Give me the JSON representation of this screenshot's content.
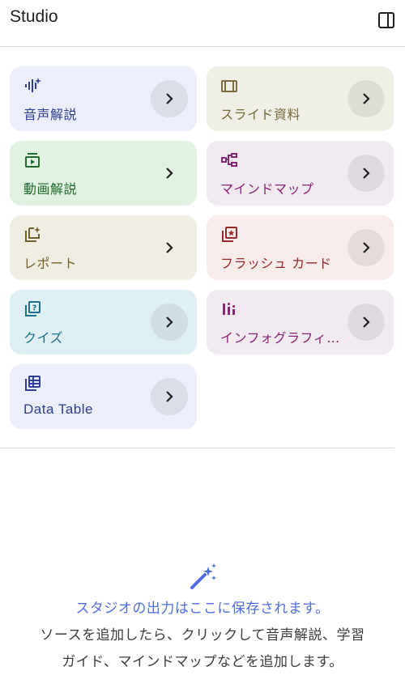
{
  "header": {
    "title": "Studio",
    "panel_icon": "side-panel-icon"
  },
  "cards": [
    {
      "label": "音声解説",
      "icon": "audio-waveform-icon",
      "bg": "#eceefb",
      "fg": "#2f3f94"
    },
    {
      "label": "スライド資料",
      "icon": "slides-icon",
      "bg": "#f0efe6",
      "fg": "#7a6a3c"
    },
    {
      "label": "動画解説",
      "icon": "video-icon",
      "bg": "#e1f2e2",
      "fg": "#1f6b2c"
    },
    {
      "label": "マインドマップ",
      "icon": "mind-map-icon",
      "bg": "#f2eaf1",
      "fg": "#8a2475"
    },
    {
      "label": "レポート",
      "icon": "report-icon",
      "bg": "#f0ede2",
      "fg": "#735f2a"
    },
    {
      "label": "フラッシュ カード",
      "icon": "flash-card-icon",
      "bg": "#f8ecea",
      "fg": "#9a2a2a"
    },
    {
      "label": "クイズ",
      "icon": "quiz-icon",
      "bg": "#dff0f5",
      "fg": "#1e6f8a"
    },
    {
      "label": "インフォグラフィ…",
      "icon": "infographic-icon",
      "bg": "#f2eaf1",
      "fg": "#8a2475"
    },
    {
      "label": "Data Table",
      "icon": "table-icon",
      "bg": "#eceefb",
      "fg": "#2f3f94"
    }
  ],
  "empty_state": {
    "icon": "magic-wand-icon",
    "line1": "スタジオの出力はここに保存されます。",
    "line2": "ソースを追加したら、クリックして音声解説、学習",
    "line3": "ガイド、マインドマップなどを追加します。"
  },
  "colors": {
    "accent": "#4e6ee0",
    "divider": "#dadce0"
  }
}
